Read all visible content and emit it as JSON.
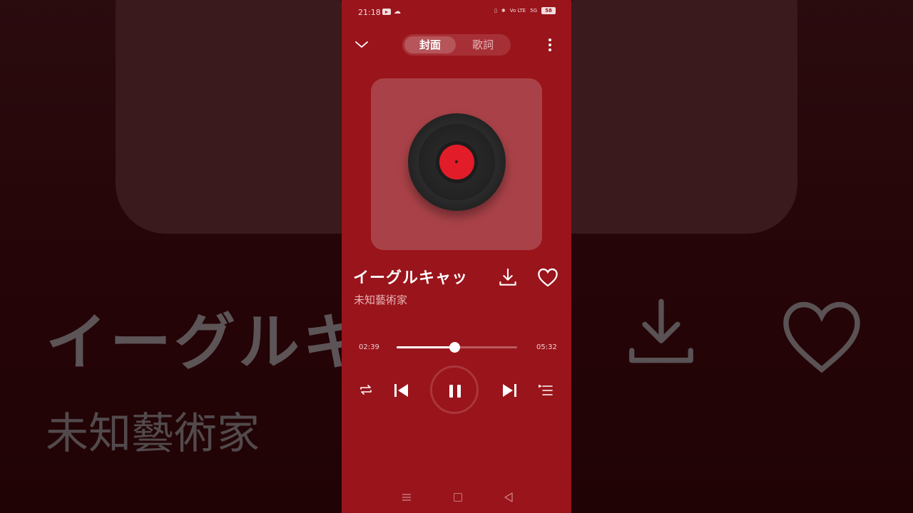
{
  "status_bar": {
    "time": "21:18",
    "network": "Vo LTE",
    "signal": "5G",
    "battery": "58"
  },
  "header": {
    "tabs": [
      {
        "label": "封面",
        "active": true
      },
      {
        "label": "歌詞",
        "active": false
      }
    ]
  },
  "song": {
    "title": "イーグルキャッ",
    "artist": "未知藝術家"
  },
  "background": {
    "title": "イーグルキャ",
    "artist": "未知藝術家"
  },
  "player": {
    "current_time": "02:39",
    "total_time": "05:32",
    "progress": 0.48,
    "state": "playing"
  },
  "colors": {
    "accent": "#9a141b",
    "vinyl_label": "#e21c28",
    "cover_bg": "#a94248"
  },
  "icons": [
    "chevron-down-icon",
    "more-vert-icon",
    "download-icon",
    "heart-icon",
    "repeat-icon",
    "previous-icon",
    "pause-icon",
    "next-icon",
    "queue-icon"
  ]
}
